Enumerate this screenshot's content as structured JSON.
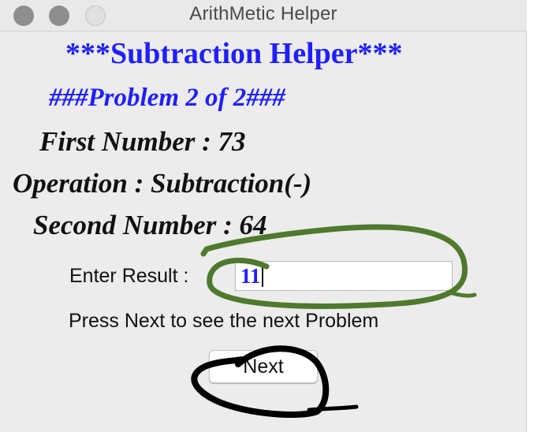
{
  "window": {
    "title": "ArithMetic Helper"
  },
  "heading": {
    "title": "***Subtraction Helper***",
    "problem": "###Problem 2 of 2###"
  },
  "problem": {
    "first_number": "First Number : 73",
    "operation": "Operation :  Subtraction(-)",
    "second_number": "Second Number : 64"
  },
  "result": {
    "label": "Enter Result :",
    "value": "11"
  },
  "hint": "Press Next to see the next Problem",
  "next_button": {
    "label": "Next"
  },
  "colors": {
    "heading_blue": "#1f1fff",
    "annotation_green": "#4f7a2e",
    "annotation_black": "#000000",
    "window_bg": "#ececec"
  },
  "icons": [
    "close-window-icon",
    "minimize-window-icon",
    "zoom-window-icon"
  ]
}
